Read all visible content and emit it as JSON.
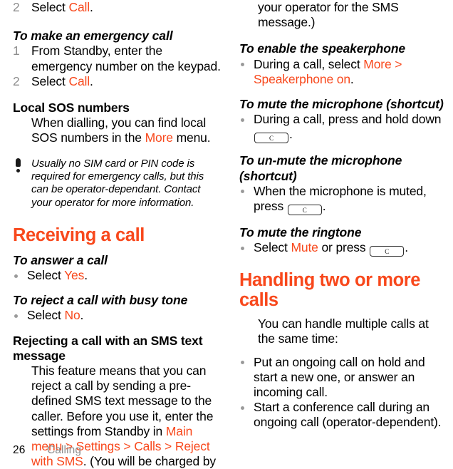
{
  "document": {
    "footer": {
      "page_number": "26",
      "section": "Calling"
    },
    "accent_color": "#f8481c",
    "muted_color": "#8d8d8d"
  },
  "left_column": {
    "step_call": {
      "number": "2",
      "text_before": "Select ",
      "link": "Call",
      "text_after": "."
    },
    "emergency": {
      "heading": "To make an emergency call",
      "steps": [
        {
          "number": "1",
          "text_before": "From Standby, enter the emergency number on the keypad.",
          "link": "",
          "text_after": ""
        },
        {
          "number": "2",
          "text_before": "Select ",
          "link": "Call",
          "text_after": "."
        }
      ]
    },
    "local_sos": {
      "heading": "Local SOS numbers",
      "text_before": "When dialling, you can find local SOS numbers in the ",
      "link": "More",
      "text_after": " menu."
    },
    "note": {
      "icon": "exclamation-icon",
      "text": "Usually no SIM card or PIN code is required for emergency calls, but this can be operator-dependant. Contact your operator for more information."
    },
    "receiving": {
      "heading": "Receiving a call",
      "answer": {
        "heading": "To answer a call",
        "bullet": {
          "text_before": "Select ",
          "link": "Yes",
          "text_after": "."
        }
      },
      "reject_busy": {
        "heading": "To reject a call with busy tone",
        "bullet": {
          "text_before": "Select ",
          "link": "No",
          "text_after": "."
        }
      },
      "reject_sms": {
        "heading": "Rejecting a call with an SMS text message",
        "text_before": "This feature means that you can reject a call by sending a pre-defined SMS text message to the caller. Before you use it, enter the settings from Standby in ",
        "link": "Main menu > Settings > Calls > Reject with SMS",
        "text_after": ". (You will be charged by"
      }
    }
  },
  "right_column": {
    "continuation": "your operator for the SMS message.)",
    "speakerphone": {
      "heading": "To enable the speakerphone",
      "bullet": {
        "text_before": "During a call, select ",
        "link": "More > Speakerphone on",
        "text_after": "."
      }
    },
    "mute_mic": {
      "heading": "To mute the microphone (shortcut)",
      "bullet": {
        "text_before": "During a call, press and hold down ",
        "key": "C",
        "text_after": "."
      }
    },
    "unmute_mic": {
      "heading": "To un-mute the microphone (shortcut)",
      "bullet": {
        "text_before": "When the microphone is muted, press ",
        "key": "C",
        "text_after": "."
      }
    },
    "mute_ringtone": {
      "heading": "To mute the ringtone",
      "bullet": {
        "text_before": "Select ",
        "link": "Mute",
        "text_mid": " or press ",
        "key": "C",
        "text_after": "."
      }
    },
    "handling": {
      "heading": "Handling two or more calls",
      "intro": "You can handle multiple calls at the same time:",
      "bullets": [
        "Put an ongoing call on hold and start a new one, or answer an incoming call.",
        "Start a conference call during an ongoing call (operator-dependent)."
      ]
    }
  }
}
